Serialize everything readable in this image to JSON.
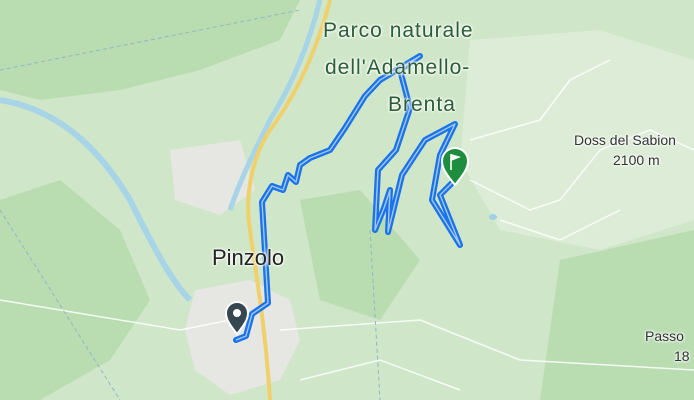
{
  "map": {
    "labels": {
      "park_line1": "Parco naturale",
      "park_line2": "dell'Adamello-",
      "park_line3": "Brenta",
      "town": "Pinzolo",
      "peak_name": "Doss del Sabion",
      "peak_elev": "2100 m",
      "pass_name": "Passo",
      "pass_elev": "18"
    },
    "route": {
      "color": "#1a73e8",
      "start_marker": "location-pin-icon",
      "end_marker": "flag-pin-icon"
    },
    "colors": {
      "land": "#cfe6c8",
      "forest": "#b6d9ae",
      "river": "#9fd0e6",
      "road_main": "#f2d678",
      "town": "#e9e9e9",
      "ski_piste": "#ffffff"
    }
  }
}
